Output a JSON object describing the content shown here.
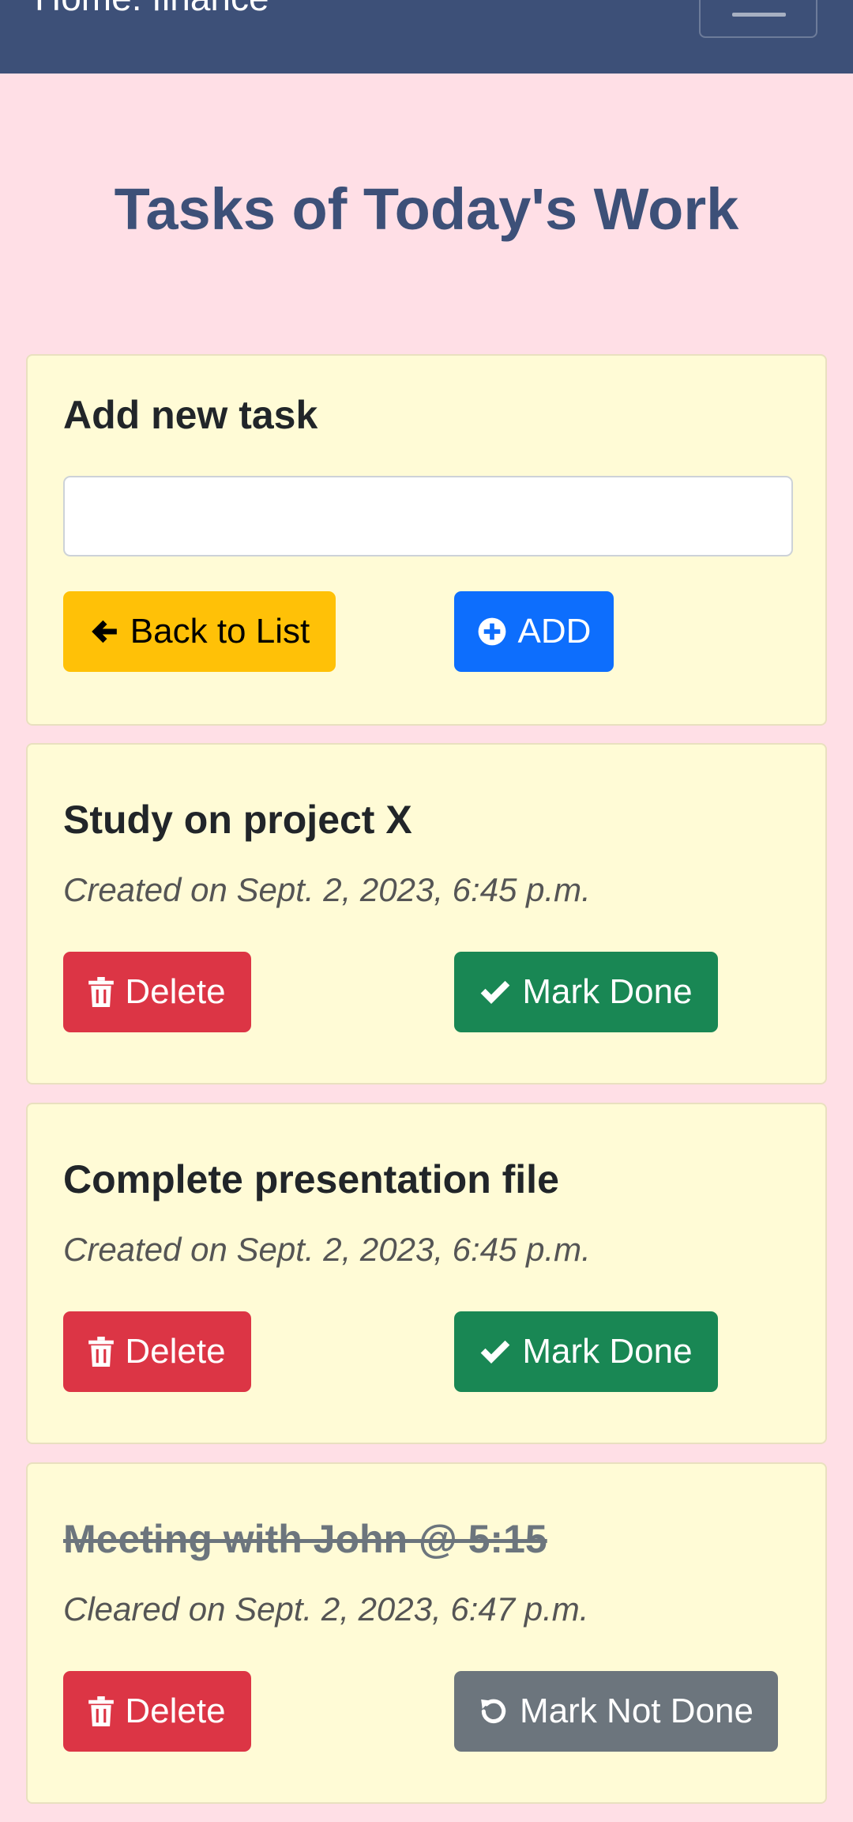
{
  "navbar": {
    "brand": "Home: finance",
    "toggler_icon": "hamburger-menu-icon"
  },
  "page": {
    "title": "Tasks of Today's Work"
  },
  "add_task": {
    "heading": "Add new task",
    "input_value": "",
    "input_placeholder": "",
    "back_label": "Back to List",
    "back_icon": "arrow-left-icon",
    "add_label": "ADD",
    "add_icon": "plus-circle-icon"
  },
  "tasks": [
    {
      "title": "Study on project X",
      "meta": "Created on Sept. 2, 2023, 6:45 p.m.",
      "done": false,
      "delete_label": "Delete",
      "toggle_label": "Mark Done"
    },
    {
      "title": "Complete presentation file",
      "meta": "Created on Sept. 2, 2023, 6:45 p.m.",
      "done": false,
      "delete_label": "Delete",
      "toggle_label": "Mark Done"
    },
    {
      "title": "Meeting with John @ 5:15",
      "meta": "Cleared on Sept. 2, 2023, 6:47 p.m.",
      "done": true,
      "delete_label": "Delete",
      "toggle_label": "Mark Not Done"
    }
  ],
  "colors": {
    "background": "#ffdfe6",
    "navbar": "#3d5078",
    "card": "#fffbd6",
    "warning": "#ffc107",
    "primary": "#0d6efd",
    "danger": "#dc3545",
    "success": "#198754",
    "secondary": "#6c757d"
  }
}
